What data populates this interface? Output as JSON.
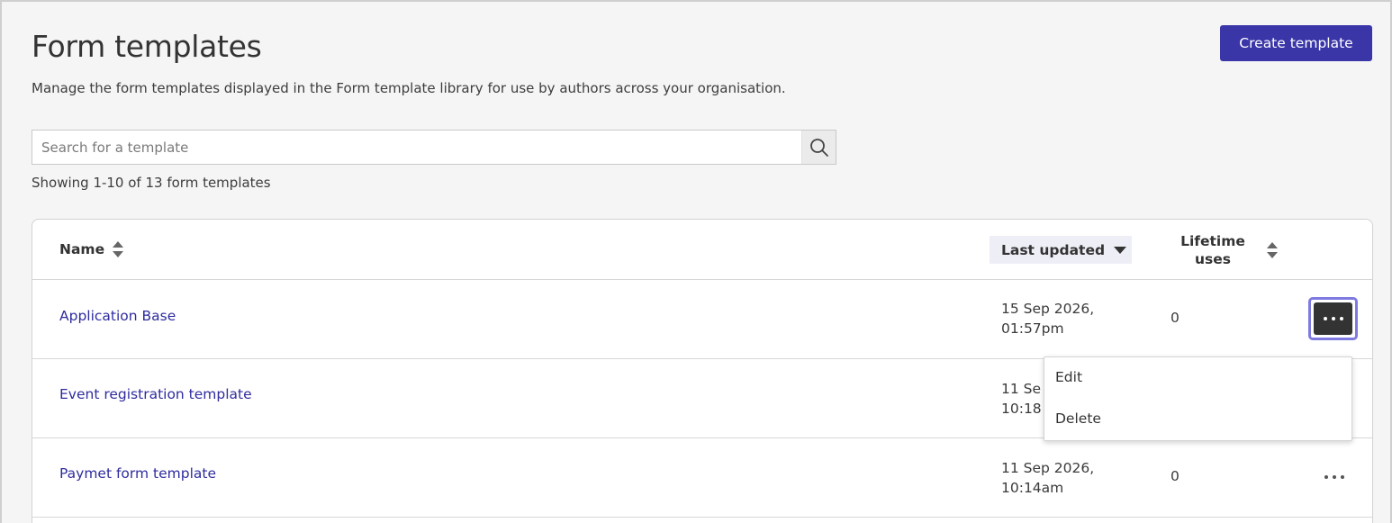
{
  "page": {
    "title": "Form templates",
    "subtitle": "Manage the form templates displayed in the Form template library for use by authors across your organisation.",
    "create_label": "Create template"
  },
  "search": {
    "placeholder": "Search for a template",
    "value": ""
  },
  "showing_text": "Showing 1-10 of 13 form templates",
  "table": {
    "headers": {
      "name": "Name",
      "last_updated": "Last updated",
      "lifetime_uses_line1": "Lifetime",
      "lifetime_uses_line2": "uses"
    },
    "rows": [
      {
        "name": "Application Base",
        "updated_date": "15 Sep 2026,",
        "updated_time": "01:57pm",
        "uses": "0"
      },
      {
        "name": "Event registration template",
        "updated_date": "11 Se",
        "updated_time": "10:18",
        "uses": ""
      },
      {
        "name": "Paymet form template",
        "updated_date": "11 Sep 2026,",
        "updated_time": "10:14am",
        "uses": "0"
      }
    ]
  },
  "menu": {
    "items": [
      "Edit",
      "Delete"
    ]
  },
  "colors": {
    "accent": "#3a36a8",
    "link": "#2f2c9e",
    "focus_ring": "#7e7ae0",
    "background": "#f5f5f5"
  },
  "icons": {
    "search": "search-icon",
    "sort": "sort-icon",
    "sort_desc": "sort-desc-icon",
    "more": "more-dots-icon"
  }
}
